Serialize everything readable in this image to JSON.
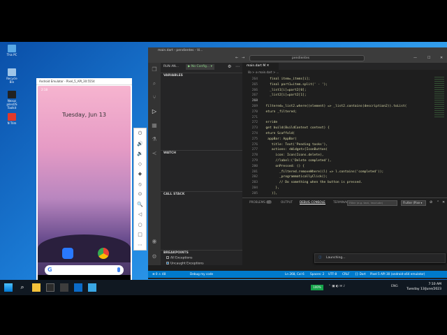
{
  "desktop": {
    "icons": [
      {
        "label": "This PC",
        "color": "#5aa9e6"
      },
      {
        "label": "Recycle Bin",
        "color": "#9fc5e8"
      },
      {
        "label": "Nexus pilesOS Toolkit",
        "color": "#222"
      },
      {
        "label": "N Trim",
        "color": "#e0392b"
      }
    ]
  },
  "emulator": {
    "title": "Android Emulator - Pixel_5_API_30:5554",
    "status_time": "2:18",
    "lock_date": "Tuesday, Jun 13",
    "tools": [
      "⏻",
      "🔊",
      "🔉",
      "◇",
      "◆",
      "⦸",
      "⊙",
      "🔍",
      "◁",
      "○",
      "□",
      "⋯"
    ]
  },
  "vscode": {
    "window_title": "main.dart - pendientes - Vi...",
    "search_text": "pendientes",
    "run_label": "RUN AN...",
    "run_config": "▶ No Config... ▾",
    "sections": {
      "variables": "VARIABLES",
      "watch": "WATCH",
      "call_stack": "CALL STACK",
      "breakpoints": "BREAKPOINTS"
    },
    "breakpoints": [
      "All Exceptions",
      "Uncaught Exceptions"
    ],
    "editor_tab": "main.dart  M ✕",
    "breadcrumb": "lib > ⊘ main.dart > ...",
    "code_lines": [
      {
        "no": "264",
        "text": "    final item=_items[i];"
      },
      {
        "no": "265",
        "text": "    final part1=item.split(' - ');"
      },
      {
        "no": "266",
        "text": "    _list1[i]=part2[0];"
      },
      {
        "no": "267",
        "text": "    _list2[i]=part2[1];"
      },
      {
        "no": "268",
        "text": ""
      },
      {
        "no": "269",
        "text": "  filtered=_list2.where((element) => _list2.contains(description2)).toList("
      },
      {
        "no": "270",
        "text": "  eturn _filtered;"
      },
      {
        "no": "271",
        "text": ""
      },
      {
        "no": "272",
        "text": "  erride"
      },
      {
        "no": "273",
        "text": "  get build(BuildContext context) {"
      },
      {
        "no": "274",
        "text": "  eturn Scaffold("
      },
      {
        "no": "275",
        "text": "   appBar: AppBar("
      },
      {
        "no": "276",
        "text": "     title: Text('Pending tasks'),"
      },
      {
        "no": "277",
        "text": "     actions: <Widget>[IconButton("
      },
      {
        "no": "278",
        "text": "       icon: Icon(Icons.delete),"
      },
      {
        "no": "279",
        "text": "       //label:('Delete completed'),"
      },
      {
        "no": "280",
        "text": "       onPressed: () {"
      },
      {
        "no": "281",
        "text": "         _filtered.removeWhere((l) => l.contains('completed'));"
      },
      {
        "no": "282",
        "text": "         _programmaticallyClick();"
      },
      {
        "no": "283",
        "text": "         // Do something when the button is pressed."
      },
      {
        "no": "284",
        "text": "       },"
      },
      {
        "no": "285",
        "text": "     )],"
      }
    ],
    "panel_tabs": [
      "PROBLEMS",
      "OUTPUT",
      "DEBUG CONSOLE",
      "TERMINAL"
    ],
    "problems_count": "47",
    "filter_placeholder": "Filter (e.g. text, !exclude)",
    "flutter_select": "Flutter (Pixe ▾",
    "toast": "Launching...",
    "status": {
      "left": "⊗ 0 ⚠ 48",
      "debug": "Debug my code",
      "ln_col": "Ln 268, Col 6",
      "spaces": "Spaces: 2",
      "encoding": "UTF-8",
      "eol": "CRLF",
      "lang": "{} Dart",
      "device": "Pixel 5 API 30 (android-x64 emulator)"
    }
  },
  "taskbar": {
    "battery": "100%",
    "lang": "ENG",
    "time": "7:10 AM",
    "date": "Tuesday 13/June/2023"
  }
}
